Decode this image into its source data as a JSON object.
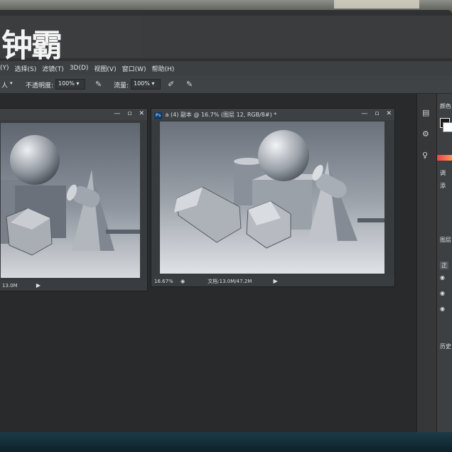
{
  "app": {
    "title_fragment": "钟霸"
  },
  "menubar": {
    "items": [
      "(Y)",
      "选择(S)",
      "滤镜(T)",
      "3D(D)",
      "视图(V)",
      "窗口(W)",
      "帮助(H)"
    ]
  },
  "options_bar": {
    "tool_fragment": "人",
    "opacity_label": "不透明度:",
    "opacity_value": "100%",
    "flow_label": "流量:",
    "flow_value": "100%"
  },
  "doc_left": {
    "status_size": "13.0M"
  },
  "doc_right": {
    "title": "a (4) 副本 @ 16.7% (图层 12, RGB/8#) *",
    "zoom": "16.67%",
    "doc_info": "文档:13.0M/47.2M"
  },
  "right_panel": {
    "labels": [
      "颜色",
      "调",
      "添",
      "图层",
      "正",
      "历史"
    ]
  },
  "colors": {
    "workspace": "#282a2c",
    "panel": "#3d4042",
    "canvas_bg": "#cdd1d6",
    "ps_badge": "#133a63"
  },
  "icons": {
    "brush": "brush-icon",
    "airbrush": "airbrush-icon",
    "pressure": "pressure-icon",
    "minimize": "minimize-icon",
    "maximize": "maximize-icon",
    "close": "close-icon",
    "play": "play-icon"
  }
}
